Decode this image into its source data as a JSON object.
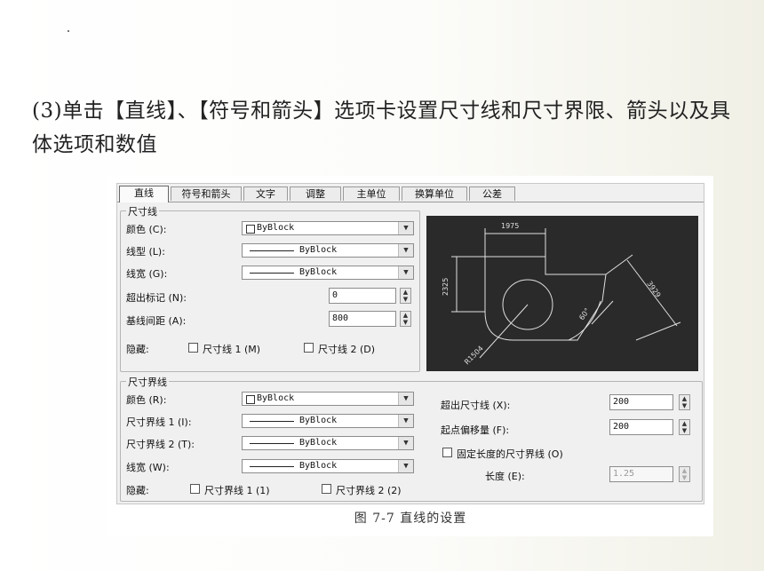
{
  "heading": "(3)单击【直线】、【符号和箭头】选项卡设置尺寸线和尺寸界限、箭头以及具体选项和数值",
  "caption": "图 7-7   直线的设置",
  "tabs": [
    "直线",
    "符号和箭头",
    "文字",
    "调整",
    "主单位",
    "换算单位",
    "公差"
  ],
  "dimension_line": {
    "title": "尺寸线",
    "color_label": "颜色 (C):",
    "color_value": "ByBlock",
    "linetype_label": "线型 (L):",
    "linetype_value": "ByBlock",
    "lineweight_label": "线宽 (G):",
    "lineweight_value": "ByBlock",
    "extend_label": "超出标记 (N):",
    "extend_value": "0",
    "baseline_label": "基线间距 (A):",
    "baseline_value": "800",
    "suppress_label": "隐藏:",
    "suppress_1": "尺寸线 1 (M)",
    "suppress_2": "尺寸线 2 (D)"
  },
  "extension_line": {
    "title": "尺寸界线",
    "color_label": "颜色 (R):",
    "color_value": "ByBlock",
    "linetype1_label": "尺寸界线 1 (I):",
    "linetype1_value": "ByBlock",
    "linetype2_label": "尺寸界线 2 (T):",
    "linetype2_value": "ByBlock",
    "lineweight_label": "线宽 (W):",
    "lineweight_value": "ByBlock",
    "suppress_label": "隐藏:",
    "suppress_1": "尺寸界线 1 (1)",
    "suppress_2": "尺寸界线 2 (2)",
    "extend_label": "超出尺寸线 (X):",
    "extend_value": "200",
    "offset_label": "起点偏移量 (F):",
    "offset_value": "200",
    "fixed_label": "固定长度的尺寸界线 (O)",
    "length_label": "长度 (E):",
    "length_value": "1.25"
  },
  "preview": {
    "dim_top": "1975",
    "dim_left": "2325",
    "dim_right": "3929",
    "dim_angle": "60°",
    "dim_radius": "R1504"
  }
}
